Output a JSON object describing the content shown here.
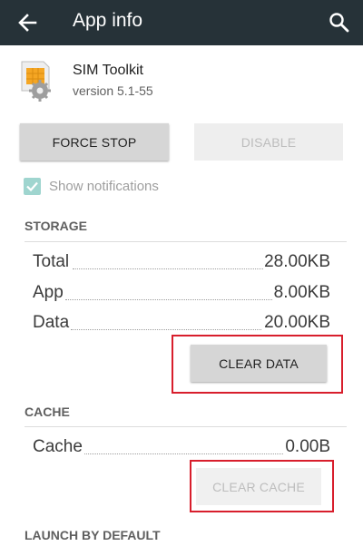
{
  "appbar": {
    "title": "App info",
    "back_icon": "arrow-back-icon",
    "search_icon": "search-icon",
    "background": "#263238"
  },
  "app": {
    "name": "SIM Toolkit",
    "version": "version 5.1-55",
    "icon": "sim-card-gear-icon"
  },
  "actions": {
    "force_stop": "FORCE STOP",
    "disable": "DISABLE"
  },
  "notifications": {
    "label": "Show notifications",
    "checked": true
  },
  "storage": {
    "header": "STORAGE",
    "rows": [
      {
        "label": "Total",
        "value": "28.00KB"
      },
      {
        "label": "App",
        "value": "8.00KB"
      },
      {
        "label": "Data",
        "value": "20.00KB"
      }
    ],
    "clear_data": "CLEAR DATA"
  },
  "cache": {
    "header": "CACHE",
    "rows": [
      {
        "label": "Cache",
        "value": "0.00B"
      }
    ],
    "clear_cache": "CLEAR CACHE"
  },
  "launch": {
    "header": "LAUNCH BY DEFAULT"
  },
  "colors": {
    "highlight": "#d81e2c",
    "checkbox": "#9fd5cf"
  }
}
